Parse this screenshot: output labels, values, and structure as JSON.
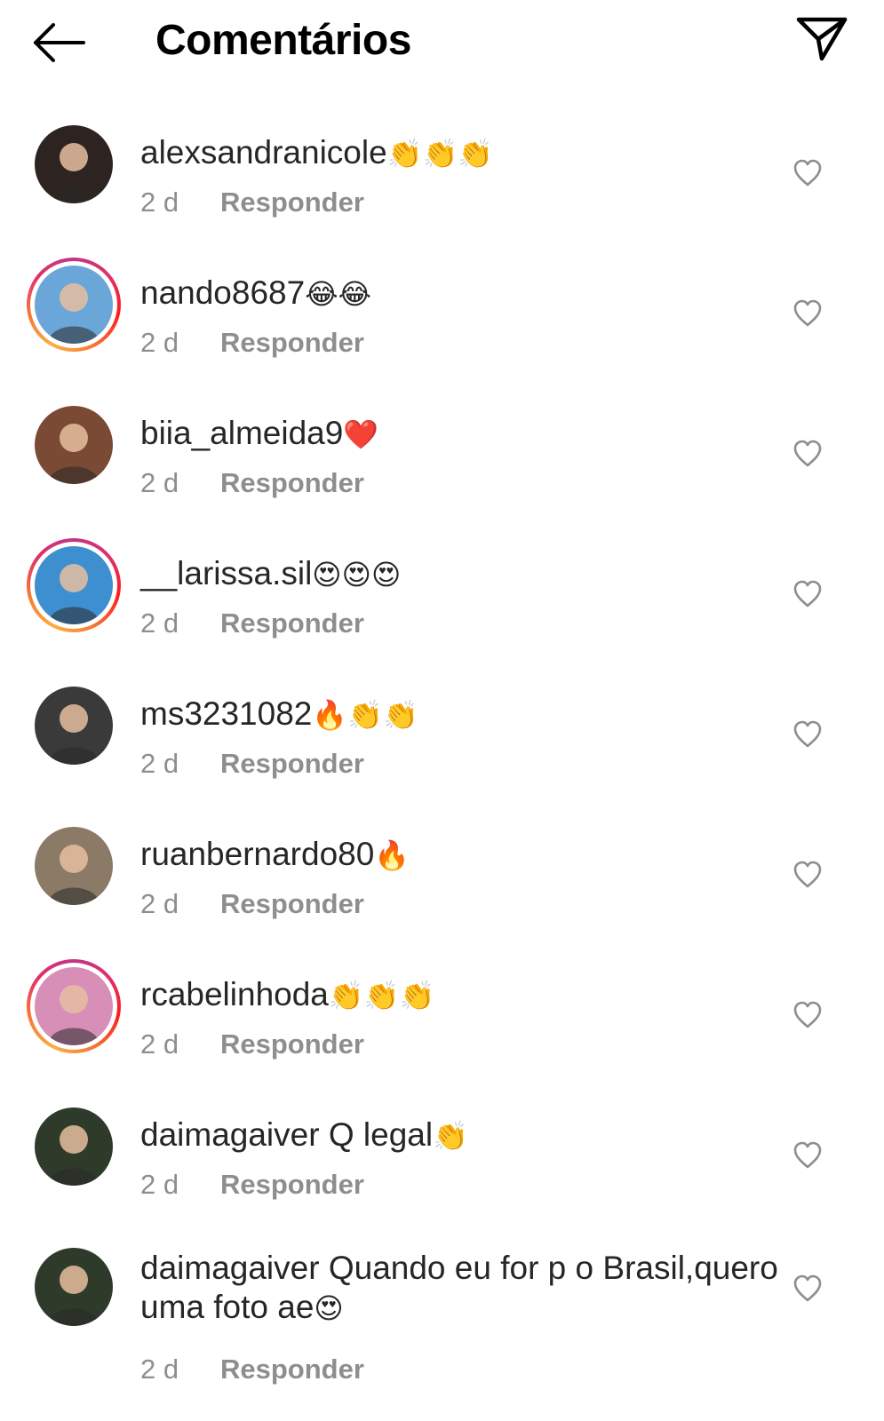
{
  "header": {
    "title": "Comentários"
  },
  "comments": [
    {
      "username": "alexsandranicole",
      "text": "",
      "emoji": "👏👏👏",
      "time": "2 d",
      "reply": "Responder",
      "ring": false,
      "avatar_color": "#2d2421"
    },
    {
      "username": "nando8687",
      "text": "",
      "emoji": "😂😂",
      "time": "2 d",
      "reply": "Responder",
      "ring": true,
      "avatar_color": "#6aa6d8"
    },
    {
      "username": "biia_almeida9",
      "text": "",
      "emoji": "❤️",
      "time": "2 d",
      "reply": "Responder",
      "ring": false,
      "avatar_color": "#7a4a34"
    },
    {
      "username": "__larissa.sil",
      "text": "",
      "emoji": "😍😍😍",
      "time": "2 d",
      "reply": "Responder",
      "ring": true,
      "avatar_color": "#3e8fd0"
    },
    {
      "username": "ms3231082",
      "text": "",
      "emoji": "🔥👏👏",
      "time": "2 d",
      "reply": "Responder",
      "ring": false,
      "avatar_color": "#3a3a3a"
    },
    {
      "username": "ruanbernardo80",
      "text": "",
      "emoji": "🔥",
      "time": "2 d",
      "reply": "Responder",
      "ring": false,
      "avatar_color": "#8b7a66"
    },
    {
      "username": "rcabelinhoda",
      "text": "",
      "emoji": "👏👏👏",
      "time": "2 d",
      "reply": "Responder",
      "ring": true,
      "avatar_color": "#d78fb8"
    },
    {
      "username": "daimagaiver",
      "text": " Q legal",
      "emoji": "👏",
      "time": "2 d",
      "reply": "Responder",
      "ring": false,
      "avatar_color": "#2f3b2a"
    },
    {
      "username": "daimagaiver",
      "text": " Quando eu for p o Brasil,quero uma foto ae",
      "emoji": "😍",
      "time": "2 d",
      "reply": "Responder",
      "ring": false,
      "avatar_color": "#2f3b2a"
    }
  ],
  "colors": {
    "text": "#262626",
    "meta": "#8e8e8e",
    "ring_start": "#c13584",
    "ring_end": "#fcaf45"
  },
  "icons": {
    "back": "arrow-left-icon",
    "send": "paper-plane-icon",
    "like": "heart-outline-icon"
  }
}
